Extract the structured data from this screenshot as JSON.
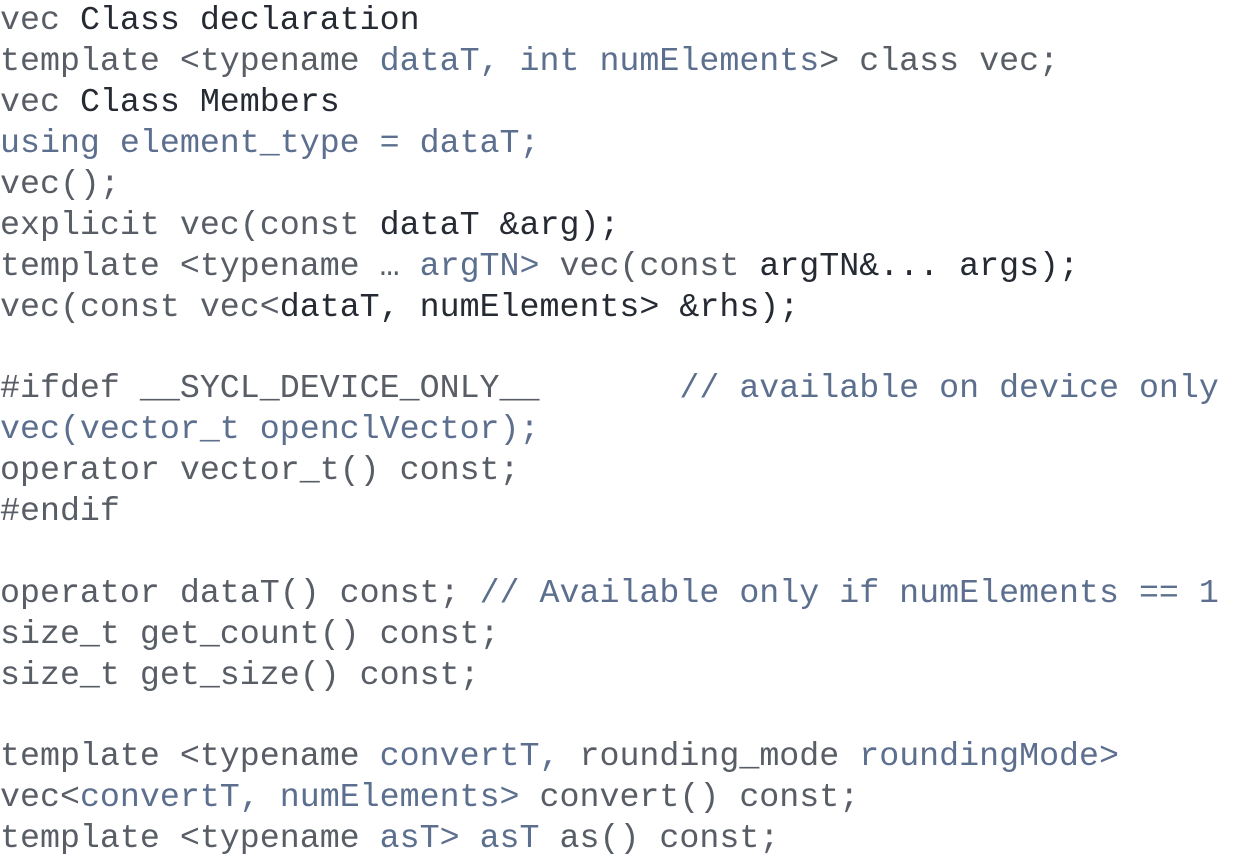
{
  "colors": {
    "dark": "#262a33",
    "gray": "#585d66",
    "blue": "#5d6f8e",
    "background": "#ffffff"
  },
  "lines": [
    {
      "segments": [
        {
          "t": "vec ",
          "c": "gray"
        },
        {
          "t": "Class declaration",
          "c": "dark"
        }
      ]
    },
    {
      "segments": [
        {
          "t": "template <typename ",
          "c": "gray"
        },
        {
          "t": "dataT, int numElements",
          "c": "blue"
        },
        {
          "t": "> class vec;",
          "c": "gray"
        }
      ]
    },
    {
      "segments": [
        {
          "t": "vec ",
          "c": "gray"
        },
        {
          "t": "Class Members",
          "c": "dark"
        }
      ]
    },
    {
      "segments": [
        {
          "t": "using element_type = dataT;",
          "c": "blue"
        }
      ]
    },
    {
      "segments": [
        {
          "t": "vec();",
          "c": "gray"
        }
      ]
    },
    {
      "segments": [
        {
          "t": "explicit vec(const ",
          "c": "gray"
        },
        {
          "t": "dataT &arg);",
          "c": "dark"
        }
      ]
    },
    {
      "segments": [
        {
          "t": "template <typename … ",
          "c": "gray"
        },
        {
          "t": "argTN> ",
          "c": "blue"
        },
        {
          "t": "vec(const ",
          "c": "gray"
        },
        {
          "t": "argTN&... args);",
          "c": "dark"
        }
      ]
    },
    {
      "segments": [
        {
          "t": "vec(const vec<",
          "c": "gray"
        },
        {
          "t": "dataT, numElements> &rhs);",
          "c": "dark"
        }
      ]
    },
    {
      "segments": []
    },
    {
      "segments": [
        {
          "t": "#ifdef __SYCL_DEVICE_ONLY__",
          "c": "gray"
        },
        {
          "t": "       ",
          "c": "gray"
        },
        {
          "t": "// available on device only",
          "c": "blue"
        }
      ]
    },
    {
      "segments": [
        {
          "t": "vec(vector_t openclVector);",
          "c": "blue"
        }
      ]
    },
    {
      "segments": [
        {
          "t": "operator vector_t() const;",
          "c": "gray"
        }
      ]
    },
    {
      "segments": [
        {
          "t": "#endif",
          "c": "gray"
        }
      ]
    },
    {
      "segments": []
    },
    {
      "segments": [
        {
          "t": "operator dataT() const; ",
          "c": "gray"
        },
        {
          "t": "// Available only if numElements == 1",
          "c": "blue"
        }
      ]
    },
    {
      "segments": [
        {
          "t": "size_t get_count() const;",
          "c": "gray"
        }
      ]
    },
    {
      "segments": [
        {
          "t": "size_t get_size() const;",
          "c": "gray"
        }
      ]
    },
    {
      "segments": []
    },
    {
      "segments": [
        {
          "t": "template <typename ",
          "c": "gray"
        },
        {
          "t": "convertT, ",
          "c": "blue"
        },
        {
          "t": "rounding_mode ",
          "c": "gray"
        },
        {
          "t": "roundingMode>",
          "c": "blue"
        }
      ]
    },
    {
      "segments": [
        {
          "t": "vec<",
          "c": "gray"
        },
        {
          "t": "convertT, numElements> ",
          "c": "blue"
        },
        {
          "t": "convert() const;",
          "c": "gray"
        }
      ]
    },
    {
      "segments": [
        {
          "t": "template <typename ",
          "c": "gray"
        },
        {
          "t": "asT> asT ",
          "c": "blue"
        },
        {
          "t": "as() const;",
          "c": "gray"
        }
      ]
    }
  ]
}
